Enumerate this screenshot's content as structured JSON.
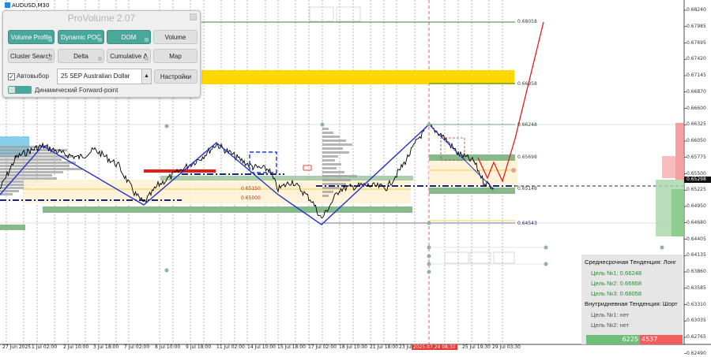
{
  "symbol": "AUDUSD,M30",
  "panel": {
    "title": "ProVolume 2.07",
    "buttons": [
      {
        "label": "Volume Profile",
        "active": true
      },
      {
        "label": "Dynamic POC",
        "active": true
      },
      {
        "label": "DOM",
        "active": true
      },
      {
        "label": "Volume",
        "active": false
      },
      {
        "label": "Cluster Search",
        "active": false
      },
      {
        "label": "Delta",
        "active": false
      },
      {
        "label": "Cumulative Δ",
        "active": false
      },
      {
        "label": "Map",
        "active": false
      }
    ],
    "auto_select_label": "Автовыбор",
    "auto_select_checked": true,
    "instrument_selected": "25 SEP Australian Dollar",
    "settings_button": "Настройки",
    "forward_point_label": "Динамический Forward-point"
  },
  "price_axis": [
    "0.68240",
    "0.67985",
    "0.67695",
    "0.67420",
    "0.67145",
    "0.66870",
    "0.66600",
    "0.66325",
    "0.66050",
    "0.65775",
    "0.65500",
    "0.65225",
    "0.64950",
    "0.64680",
    "0.64405",
    "0.64135",
    "0.63860",
    "0.63585",
    "0.63310",
    "0.63035",
    "0.62765",
    "0.62490"
  ],
  "current_price": "0.65298",
  "levels": [
    {
      "label": "0.68058",
      "color": "#2e8b3a"
    },
    {
      "label": "0.66958",
      "color": "#2e8b3a"
    },
    {
      "label": "0.66248",
      "color": "#2e8b3a"
    },
    {
      "label": "0.65698",
      "color": "#2e8b3a"
    },
    {
      "label": "0.65148",
      "color": "#2e8b3a"
    },
    {
      "label": "0.64543",
      "color": "#1a237e"
    }
  ],
  "mid_levels": [
    "0.65150",
    "0.65000"
  ],
  "dates": [
    "27 Jun 2025",
    "1 Jul 02:00",
    "2 Jul 10:00",
    "3 Jul 18:00",
    "7 Jul 02:00",
    "8 Jul 10:00",
    "9 Jul 18:00",
    "11 Jul 02:00",
    "14 Jul 10:00",
    "15 Jul 18:00",
    "17 Jul 02:00",
    "18 Jul 10:00",
    "21 Jul 18:00",
    "23 Jul 02:00",
    "2025.07.24 08:30",
    "25 Jul 19:30",
    "29 Jul 03:30"
  ],
  "trend": {
    "mid_term_label": "Среднесрочная Тенденция: Лонг",
    "targets_long": [
      "Цель №1: 0.66248",
      "Цель №2: 0.66958",
      "Цель №3: 0.68058"
    ],
    "intraday_label": "Внутридневная Тенденция: Шорт",
    "targets_short": [
      "Цель №1: нет",
      "Цель №2: нет"
    ],
    "buy_volume": "6225",
    "sell_volume": "4537"
  },
  "colors": {
    "accent": "#4aa79a",
    "trend_line": "#2233cc",
    "target_green": "#2e8b3a",
    "forecast_red": "#e31b1b",
    "zone_yellow": "#ffd600",
    "zone_green": "#88b98a"
  }
}
